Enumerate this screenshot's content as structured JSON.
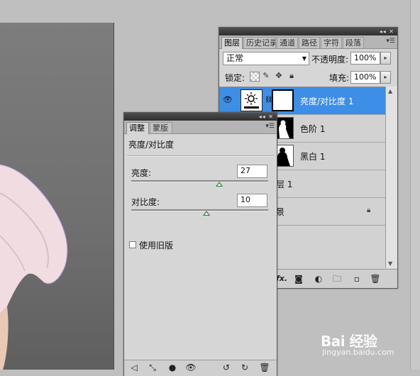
{
  "layers_panel": {
    "tabs": [
      "图层",
      "历史记录",
      "通道",
      "路径",
      "字符",
      "段落"
    ],
    "blend_mode": "正常",
    "opacity_label": "不透明度:",
    "opacity_value": "100%",
    "lock_label": "锁定:",
    "fill_label": "填充:",
    "fill_value": "100%",
    "layers": [
      {
        "name": "亮度/对比度 1",
        "selected": true,
        "type": "adjustment"
      },
      {
        "name": "色阶 1",
        "selected": false,
        "type": "adjustment"
      },
      {
        "name": "黑白 1",
        "selected": false,
        "type": "adjustment"
      },
      {
        "name": "层 1",
        "selected": false,
        "type": "pixel"
      },
      {
        "name": "景",
        "selected": false,
        "type": "background"
      }
    ]
  },
  "adjustments_panel": {
    "tabs": [
      "调整",
      "蒙版"
    ],
    "title": "亮度/对比度",
    "brightness_label": "亮度:",
    "brightness_value": "27",
    "brightness_level": 0.64,
    "contrast_label": "对比度:",
    "contrast_value": "10",
    "contrast_level": 0.55,
    "legacy_label": "使用旧版",
    "legacy_checked": false
  },
  "watermark": {
    "main": "Bai 经验",
    "sub": "jingyan.baidu.com"
  },
  "colors": {
    "selection": "#3d8ee6",
    "slider_thumb": "#2e7d2e",
    "panel_bg": "#d6d6d6"
  }
}
